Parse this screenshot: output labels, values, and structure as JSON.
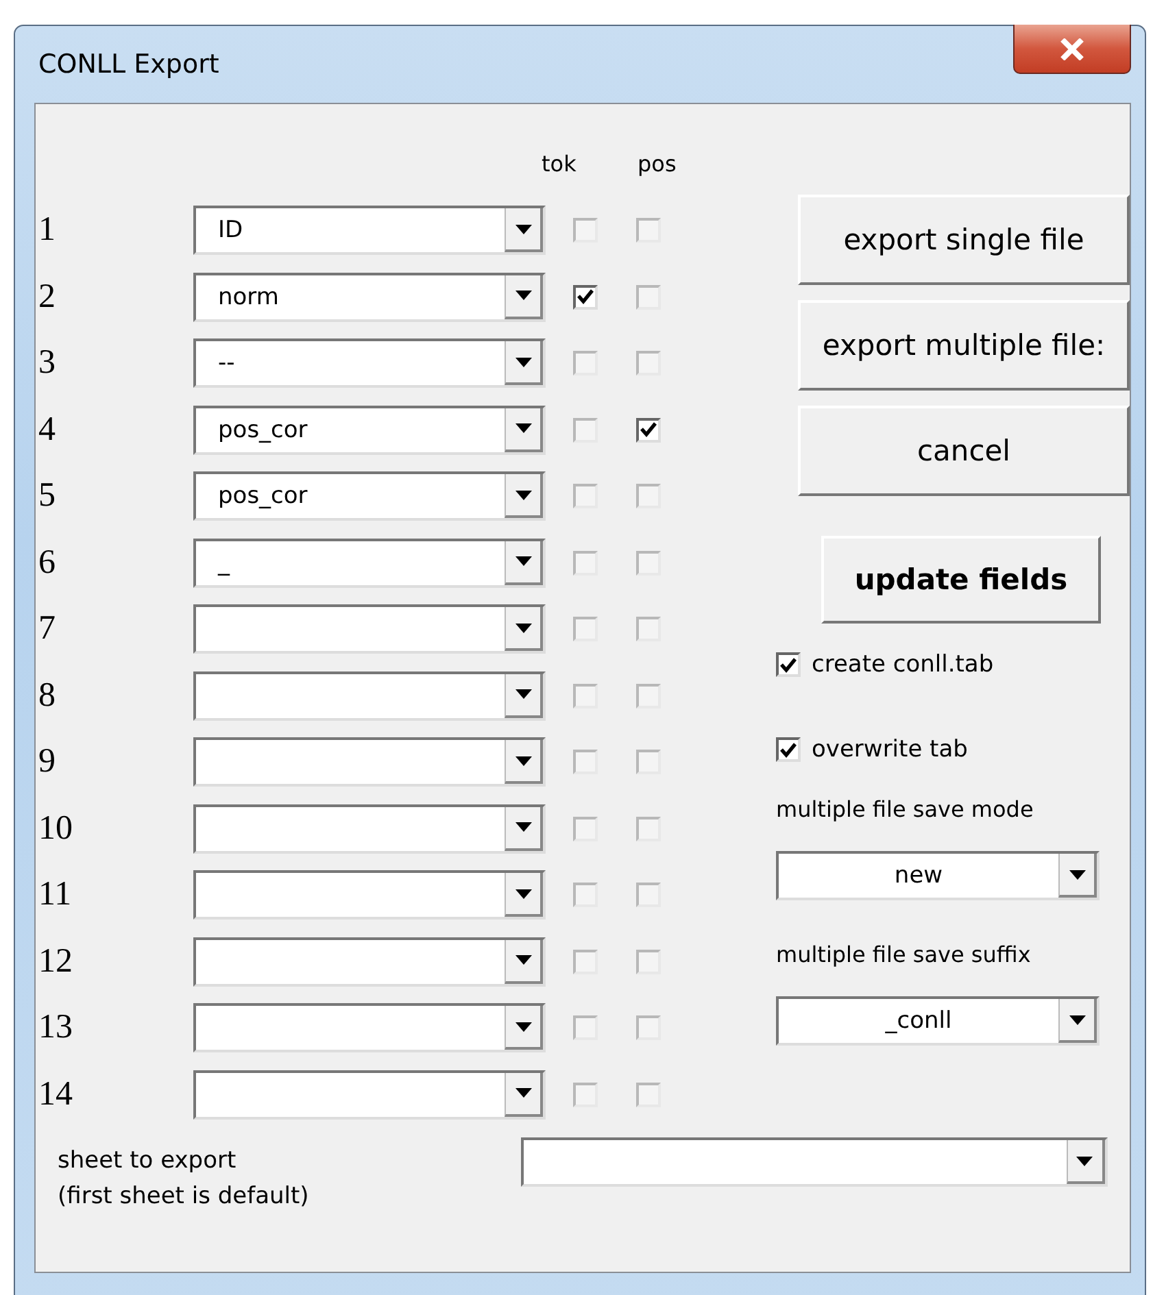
{
  "window": {
    "title": "CONLL Export"
  },
  "column_headers": [
    "tok",
    "pos"
  ],
  "rows": [
    {
      "number": "1",
      "field": "ID",
      "tok": false,
      "pos": false
    },
    {
      "number": "2",
      "field": "norm",
      "tok": true,
      "pos": false
    },
    {
      "number": "3",
      "field": "--",
      "tok": false,
      "pos": false
    },
    {
      "number": "4",
      "field": "pos_cor",
      "tok": false,
      "pos": true
    },
    {
      "number": "5",
      "field": "pos_cor",
      "tok": false,
      "pos": false
    },
    {
      "number": "6",
      "field": "_",
      "tok": false,
      "pos": false
    },
    {
      "number": "7",
      "tok": false,
      "pos": false
    },
    {
      "number": "8",
      "tok": false,
      "pos": false
    },
    {
      "number": "9",
      "tok": false,
      "pos": false
    },
    {
      "number": "10",
      "tok": false,
      "pos": false
    },
    {
      "number": "11",
      "tok": false,
      "pos": false
    },
    {
      "number": "12",
      "tok": false,
      "pos": false
    },
    {
      "number": "13",
      "tok": false,
      "pos": false
    },
    {
      "number": "14",
      "tok": false,
      "pos": false
    }
  ],
  "buttons": [
    "export single file",
    "export multiple file:",
    "cancel"
  ],
  "update_button": "update fields",
  "options": [
    {
      "label": "create conll.tab",
      "checked": true
    },
    {
      "label": "overwrite tab",
      "checked": true
    }
  ],
  "save_mode": {
    "label": "multiple file save mode",
    "value": "new"
  },
  "save_suffix": {
    "label": "multiple file save suffix",
    "value": "_conll"
  },
  "sheet": {
    "label_lines": [
      "sheet to export",
      "(first sheet is default)"
    ]
  }
}
